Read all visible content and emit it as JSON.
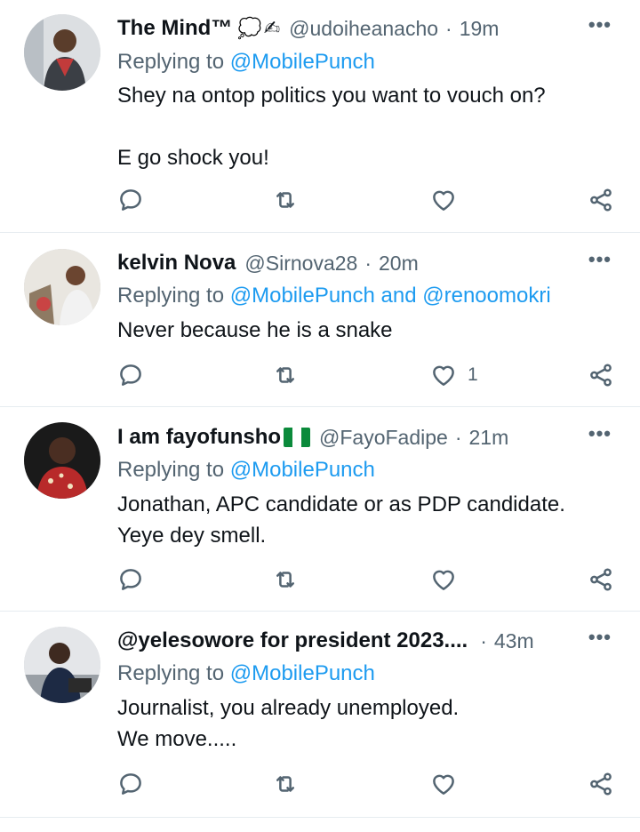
{
  "colors": {
    "link": "#1d9bf0",
    "muted": "#536471",
    "text": "#0f1419",
    "divider": "#e6ecf0"
  },
  "tweets": [
    {
      "name": "The Mind™",
      "name_suffix_icons": [
        "thought-balloon-emoji",
        "writing-hand-emoji"
      ],
      "handle": "@udoiheanacho",
      "time": "19m",
      "reply_prefix": "Replying to",
      "reply_mentions": "@MobilePunch",
      "text": "Shey na ontop politics you want to vouch on?\n\nE go shock you!",
      "likes": ""
    },
    {
      "name": "kelvin Nova",
      "handle": "@Sirnova28",
      "time": "20m",
      "reply_prefix": "Replying to",
      "reply_mentions": "@MobilePunch and @renoomokri",
      "text": "Never because he is a snake",
      "likes": "1"
    },
    {
      "name": "I am fayofunsho",
      "name_suffix_icons": [
        "nigeria-flag-emoji"
      ],
      "handle": "@FayoFadipe",
      "time": "21m",
      "reply_prefix": "Replying to",
      "reply_mentions": "@MobilePunch",
      "text": "Jonathan, APC candidate or as PDP candidate.\nYeye dey smell.",
      "likes": ""
    },
    {
      "name": "@yelesowore for president 2023....",
      "handle": "",
      "time": "43m",
      "reply_prefix": "Replying to",
      "reply_mentions": "@MobilePunch",
      "text": "Journalist, you already unemployed.\nWe move.....",
      "likes": ""
    }
  ],
  "icons": [
    "reply-icon",
    "retweet-icon",
    "like-icon",
    "share-icon",
    "more-options-icon"
  ]
}
